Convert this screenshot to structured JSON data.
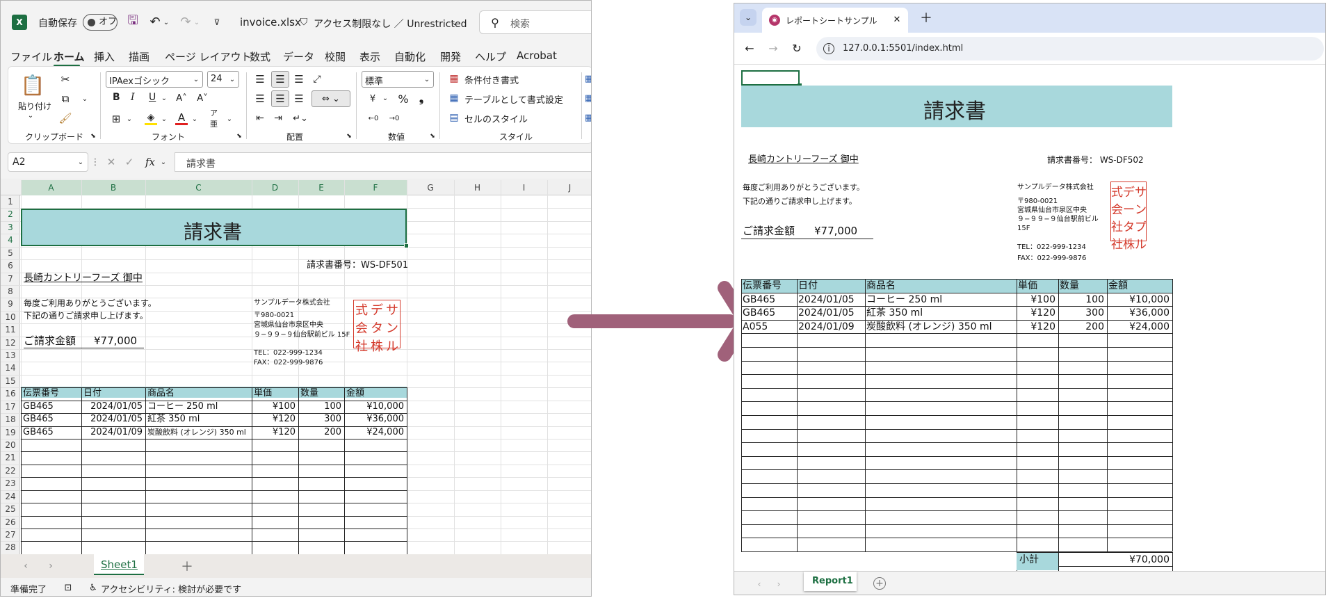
{
  "excel": {
    "autosave_label": "自動保存",
    "autosave_state": "オフ",
    "filename": "invoice.xlsx",
    "access_label": "アクセス制限なし ／ Unrestricted",
    "search_placeholder": "検索",
    "menu_tabs": [
      "ファイル",
      "ホーム",
      "挿入",
      "描画",
      "ページ レイアウト",
      "数式",
      "データ",
      "校閲",
      "表示",
      "自動化",
      "開発",
      "ヘルプ",
      "Acrobat"
    ],
    "ribbon": {
      "paste_label": "貼り付け",
      "clipboard_group": "クリップボード",
      "font_name": "IPAexゴシック",
      "font_size": "24",
      "bold": "B",
      "italic": "I",
      "underline": "U",
      "font_group": "フォント",
      "align_group": "配置",
      "number_format": "標準",
      "number_group": "数値",
      "conditional_format": "条件付き書式",
      "table_format": "テーブルとして書式設定",
      "cell_style": "セルのスタイル",
      "style_group": "スタイル"
    },
    "name_box": "A2",
    "formula": "請求書",
    "columns": [
      "A",
      "B",
      "C",
      "D",
      "E",
      "F",
      "G",
      "H",
      "I",
      "J"
    ],
    "rows": [
      "1",
      "2",
      "3",
      "4",
      "5",
      "6",
      "7",
      "8",
      "9",
      "10",
      "11",
      "12",
      "13",
      "14",
      "15",
      "16",
      "17",
      "18",
      "19",
      "20",
      "21",
      "22",
      "23",
      "24",
      "25",
      "26",
      "27",
      "28"
    ],
    "invoice": {
      "title": "請求書",
      "invoice_no": "請求書番号：WS-DF501",
      "customer": "長崎カントリーフーズ 御中",
      "greeting1": "毎度ご利用ありがとうございます。",
      "greeting2": "下記の通りご請求申し上げます。",
      "amount_label": "ご請求金額",
      "amount_value": "¥77,000",
      "company": "サンプルデータ株式会社",
      "postal": "〒980-0021",
      "address1": "宮城県仙台市泉区中央",
      "address2": "９−９９−９仙台駅前ビル 15F",
      "tel": "TEL：022-999-1234",
      "fax": "FAX：022-999-9876",
      "seal": [
        "サ",
        "デ",
        "式",
        "ン",
        "ー",
        "会",
        "プ",
        "タ",
        "社",
        "ル",
        "株",
        "社"
      ],
      "headers": [
        "伝票番号",
        "日付",
        "商品名",
        "単価",
        "数量",
        "金額"
      ],
      "items": [
        [
          "GB465",
          "2024/01/05",
          "コーヒー 250 ml",
          "¥100",
          "100",
          "¥10,000"
        ],
        [
          "GB465",
          "2024/01/05",
          "紅茶 350 ml",
          "¥120",
          "300",
          "¥36,000"
        ],
        [
          "GB465",
          "2024/01/09",
          "炭酸飲料 (オレンジ) 350 ml",
          "¥120",
          "200",
          "¥24,000"
        ]
      ]
    },
    "sheet_tab": "Sheet1",
    "status_ready": "準備完了",
    "accessibility": "アクセシビリティ: 検討が必要です"
  },
  "browser": {
    "tab_title": "レポートシートサンプル",
    "url": "127.0.0.1:5501/index.html",
    "invoice": {
      "title": "請求書",
      "customer": "長崎カントリーフーズ 御中",
      "invoice_no": "請求書番号： WS-DF502",
      "greeting1": "毎度ご利用ありがとうございます。",
      "greeting2": "下記の通りご請求申し上げます。",
      "amount_label": "ご請求金額",
      "amount_value": "¥77,000",
      "company": "サンプルデータ株式会社",
      "postal": "〒980-0021",
      "address1": "宮城県仙台市泉区中央",
      "address2": "９−９９−９仙台駅前ビル",
      "address3": "15F",
      "tel": "TEL：022-999-1234",
      "fax": "FAX：022-999-9876",
      "headers": [
        "伝票番号",
        "日付",
        "商品名",
        "単価",
        "数量",
        "金額"
      ],
      "items": [
        [
          "GB465",
          "2024/01/05",
          "コーヒー 250 ml",
          "¥100",
          "100",
          "¥10,000"
        ],
        [
          "GB465",
          "2024/01/05",
          "紅茶 350 ml",
          "¥120",
          "300",
          "¥36,000"
        ],
        [
          "A055",
          "2024/01/09",
          "炭酸飲料 (オレンジ) 350 ml",
          "¥120",
          "200",
          "¥24,000"
        ]
      ],
      "subtotal_label": "小計",
      "subtotal_value": "¥70,000"
    },
    "sheet_tab": "Report1"
  },
  "colors": {
    "title_fill": "#a8d8dc",
    "excel_green": "#1d6f42",
    "seal_red": "#d43a2c",
    "arrow": "#a0617a",
    "browser_tab_bg": "#d9e3f6"
  }
}
